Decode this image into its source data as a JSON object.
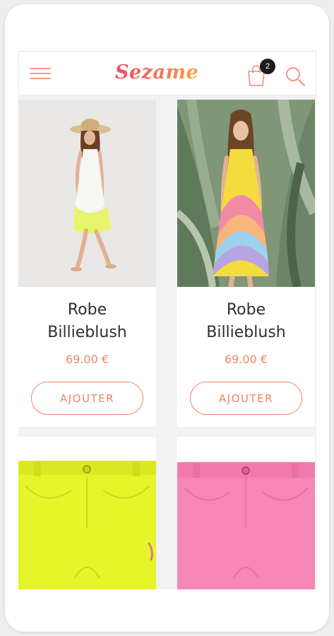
{
  "header": {
    "brand": "Sezame",
    "cart_count": "2",
    "menu_icon": "hamburger-menu-icon",
    "cart_icon": "shopping-bag-icon",
    "search_icon": "search-icon"
  },
  "colors": {
    "accent": "#f08562",
    "logo_gradient": [
      "#ec4f6b",
      "#f7a64a"
    ]
  },
  "products": [
    {
      "name_line1": "Robe",
      "name_line2": "Billieblush",
      "price": "69.00 €",
      "button": "AJOUTER",
      "image": "girl-white-neon-dress-photo"
    },
    {
      "name_line1": "Robe",
      "name_line2": "Billieblush",
      "price": "69.00 €",
      "button": "AJOUTER",
      "image": "girl-rainbow-pleated-dress-photo"
    },
    {
      "image": "neon-yellow-denim-shorts-photo"
    },
    {
      "image": "pink-denim-shorts-photo"
    }
  ]
}
